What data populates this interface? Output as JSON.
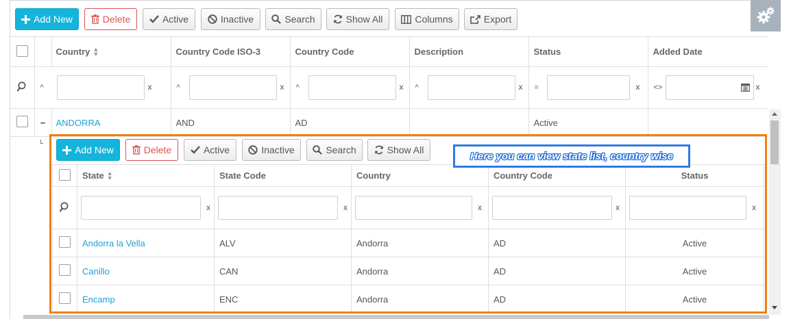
{
  "toolbar": {
    "add_new": "Add New",
    "delete": "Delete",
    "active": "Active",
    "inactive": "Inactive",
    "search": "Search",
    "show_all": "Show All",
    "columns": "Columns",
    "export": "Export"
  },
  "country_grid": {
    "headers": [
      "Country",
      "Country Code ISO-3",
      "Country Code",
      "Description",
      "Status",
      "Added Date"
    ],
    "filter_ops": [
      "^",
      "^",
      "^",
      "^",
      "=",
      "<>"
    ],
    "filter_clear": "x",
    "row": {
      "expander": "−",
      "country": "ANDORRA",
      "iso3": "AND",
      "code": "AD",
      "description": "",
      "status": "Active",
      "added_date": ""
    }
  },
  "state_toolbar": {
    "add_new": "Add New",
    "delete": "Delete",
    "active": "Active",
    "inactive": "Inactive",
    "search": "Search",
    "show_all": "Show All"
  },
  "callout": "Here you can view state list, country wise",
  "state_grid": {
    "headers": [
      "State",
      "State Code",
      "Country",
      "Country Code",
      "Status"
    ],
    "filter_clear": "x",
    "rows": [
      {
        "state": "Andorra la Vella",
        "code": "ALV",
        "country": "Andorra",
        "country_code": "AD",
        "status": "Active"
      },
      {
        "state": "Canillo",
        "code": "CAN",
        "country": "Andorra",
        "country_code": "AD",
        "status": "Active"
      },
      {
        "state": "Encamp",
        "code": "ENC",
        "country": "Andorra",
        "country_code": "AD",
        "status": "Active"
      }
    ]
  },
  "colors": {
    "primary": "#15b4dd",
    "danger": "#d9534f",
    "link": "#1ea1d3",
    "highlight_box": "#f08010",
    "callout_border": "#2e7ae4"
  }
}
